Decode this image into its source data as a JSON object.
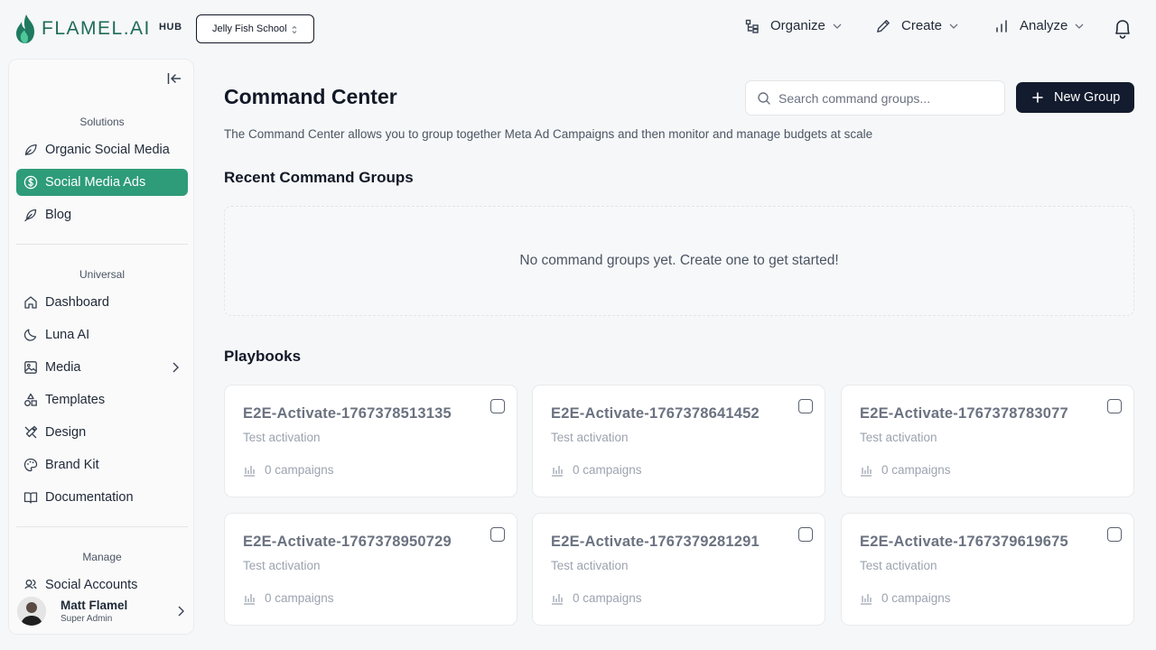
{
  "brand": {
    "name": "FLAMEL.AI",
    "badge": "HUB",
    "accent": "#2e9c78",
    "dark_button": "#131b2e"
  },
  "workspace": {
    "selected": "Jelly Fish School"
  },
  "topnav": [
    {
      "label": "Organize",
      "icon": "organize-icon"
    },
    {
      "label": "Create",
      "icon": "pen-icon"
    },
    {
      "label": "Analyze",
      "icon": "bar-chart-icon"
    }
  ],
  "sidebar": {
    "sections": [
      {
        "title": "Solutions"
      },
      {
        "title": "Universal"
      },
      {
        "title": "Manage"
      }
    ],
    "items": [
      {
        "label": "Organic Social Media",
        "icon": "leaf-icon"
      },
      {
        "label": "Social Media Ads",
        "icon": "dollar-circle-icon",
        "active": true
      },
      {
        "label": "Blog",
        "icon": "feather-icon"
      },
      {
        "label": "Dashboard",
        "icon": "home-icon"
      },
      {
        "label": "Luna AI",
        "icon": "moon-icon"
      },
      {
        "label": "Media",
        "icon": "image-icon"
      },
      {
        "label": "Templates",
        "icon": "shapes-icon"
      },
      {
        "label": "Design",
        "icon": "pencil-ruler-icon"
      },
      {
        "label": "Brand Kit",
        "icon": "palette-icon"
      },
      {
        "label": "Documentation",
        "icon": "book-icon"
      },
      {
        "label": "Social Accounts",
        "icon": "users-icon"
      }
    ],
    "user": {
      "name": "Matt Flamel",
      "role": "Super Admin"
    }
  },
  "main": {
    "title": "Command Center",
    "description": "The Command Center allows you to group together Meta Ad Campaigns and then monitor and manage budgets at scale",
    "search": {
      "placeholder": "Search command groups...",
      "value": ""
    },
    "new_group_label": "New Group",
    "recent": {
      "title": "Recent Command Groups",
      "empty_text": "No command groups yet. Create one to get started!"
    },
    "playbooks": {
      "title": "Playbooks",
      "cards": [
        {
          "title": "E2E-Activate-1767378513135",
          "subtitle": "Test activation",
          "campaigns": "0 campaigns"
        },
        {
          "title": "E2E-Activate-1767378641452",
          "subtitle": "Test activation",
          "campaigns": "0 campaigns"
        },
        {
          "title": "E2E-Activate-1767378783077",
          "subtitle": "Test activation",
          "campaigns": "0 campaigns"
        },
        {
          "title": "E2E-Activate-1767378950729",
          "subtitle": "Test activation",
          "campaigns": "0 campaigns"
        },
        {
          "title": "E2E-Activate-1767379281291",
          "subtitle": "Test activation",
          "campaigns": "0 campaigns"
        },
        {
          "title": "E2E-Activate-1767379619675",
          "subtitle": "Test activation",
          "campaigns": "0 campaigns"
        }
      ]
    }
  }
}
